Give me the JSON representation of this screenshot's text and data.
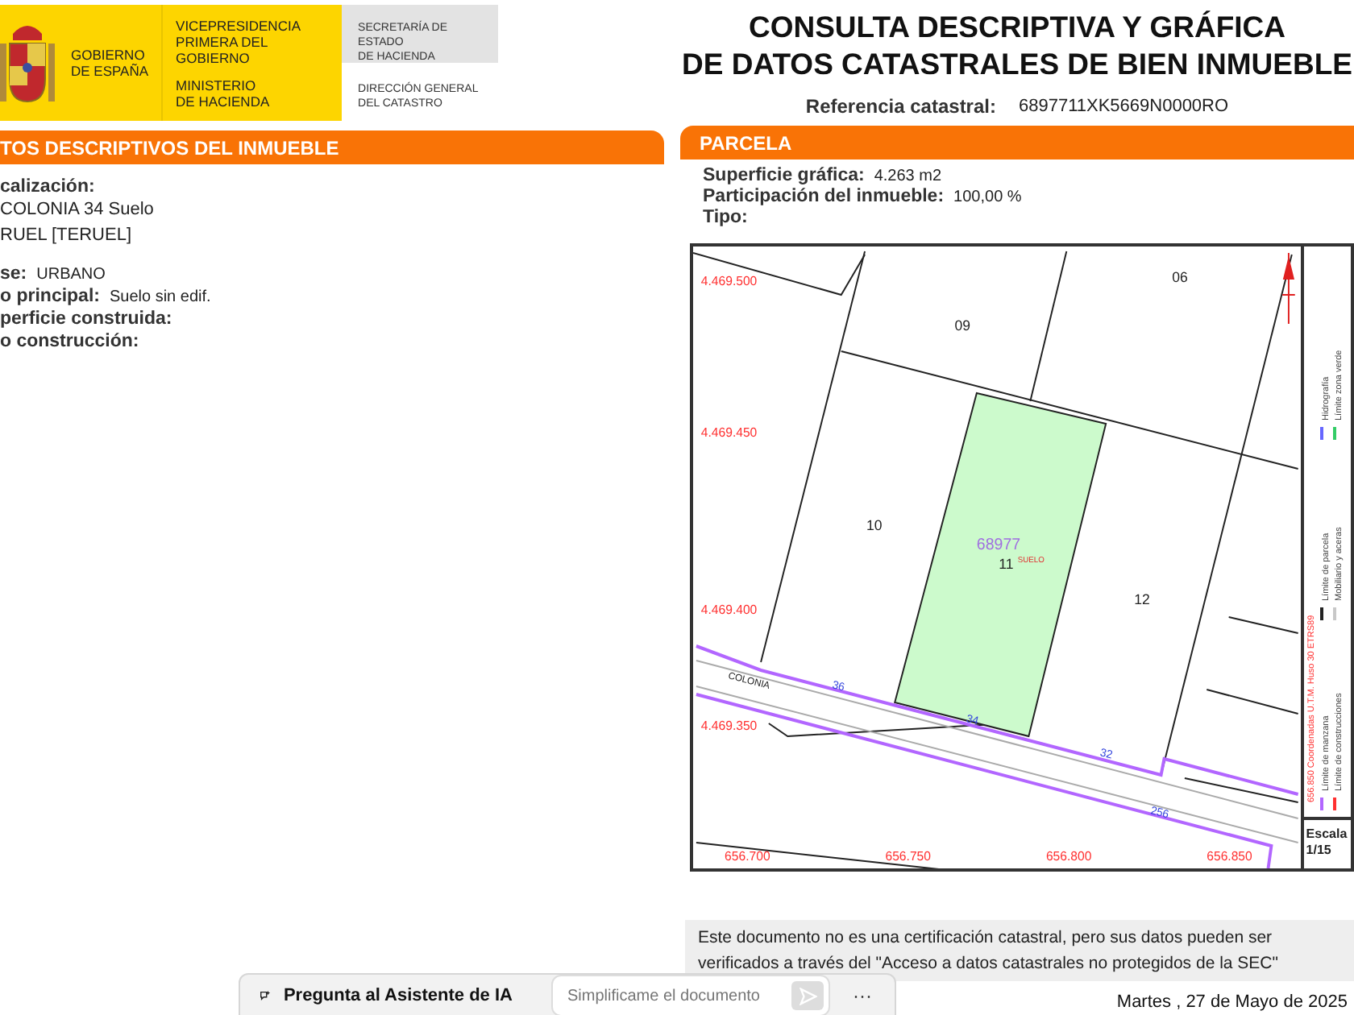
{
  "header": {
    "government": [
      "GOBIERNO",
      "DE ESPAÑA"
    ],
    "vice_presidency": [
      "VICEPRESIDENCIA",
      "PRIMERA DEL GOBIERNO"
    ],
    "ministry": [
      "MINISTERIO",
      "DE HACIENDA"
    ],
    "secretariat": [
      "SECRETARÍA DE ESTADO",
      "DE HACIENDA"
    ],
    "directorate": [
      "DIRECCIÓN GENERAL",
      "DEL CATASTRO"
    ]
  },
  "title": [
    "CONSULTA DESCRIPTIVA Y GRÁFICA",
    "DE DATOS CATASTRALES DE BIEN INMUEBLE"
  ],
  "reference": {
    "label": "Referencia catastral:",
    "value": "6897711XK5669N0000RO"
  },
  "descriptive": {
    "heading": "TOS DESCRIPTIVOS DEL INMUEBLE",
    "location": {
      "label": "calización:",
      "lines": [
        "COLONIA 34 Suelo",
        "RUEL [TERUEL]"
      ]
    },
    "fields": [
      {
        "label": "se:",
        "value": "URBANO"
      },
      {
        "label": "o principal:",
        "value": "Suelo sin edif."
      },
      {
        "label": "perficie construida:"
      },
      {
        "label": "o construcción:"
      }
    ]
  },
  "parcel": {
    "heading": "PARCELA",
    "fields": [
      {
        "label": "Superficie gráfica:",
        "value": "4.263 m2"
      },
      {
        "label": "Participación del inmueble:",
        "value": "100,00 %"
      },
      {
        "label": "Tipo:"
      }
    ]
  },
  "map": {
    "northings": [
      "4.469.500",
      "4.469.450",
      "4.469.400",
      "4.469.350"
    ],
    "eastings": [
      "656.700",
      "656.750",
      "656.800",
      "656.850"
    ],
    "parcels": [
      "06",
      "09",
      "10",
      "11",
      "12"
    ],
    "block_number": "68977",
    "land_use": "SUELO",
    "street": "COLONIA",
    "house_numbers": [
      "36",
      "34",
      "32",
      "256"
    ],
    "coordinates_note": "656.850 Coordenadas U.T.M. Huso 30 ETRS89",
    "legend": [
      {
        "label": "Límite de manzana",
        "color": "#b266ff"
      },
      {
        "label": "Límite de construcciones",
        "color": "#ff3030"
      },
      {
        "label": "Límite de parcela",
        "color": "#222222"
      },
      {
        "label": "Mobiliario y aceras",
        "color": "#c8c8c8"
      },
      {
        "label": "Hidrografía",
        "color": "#6666ff"
      },
      {
        "label": "Límite zona verde",
        "color": "#33cc66"
      }
    ],
    "scale": {
      "label": "Escala",
      "value": "1/15"
    }
  },
  "note": "Este documento no es una certificación catastral, pero sus datos pueden ser verificados a través del \"Acceso a datos catastrales no protegidos de la SEC\"",
  "assistant": {
    "label": "Pregunta al Asistente de IA",
    "placeholder": "Simplificame el documento",
    "more": "···"
  },
  "date": "Martes , 27 de Mayo de 2025"
}
